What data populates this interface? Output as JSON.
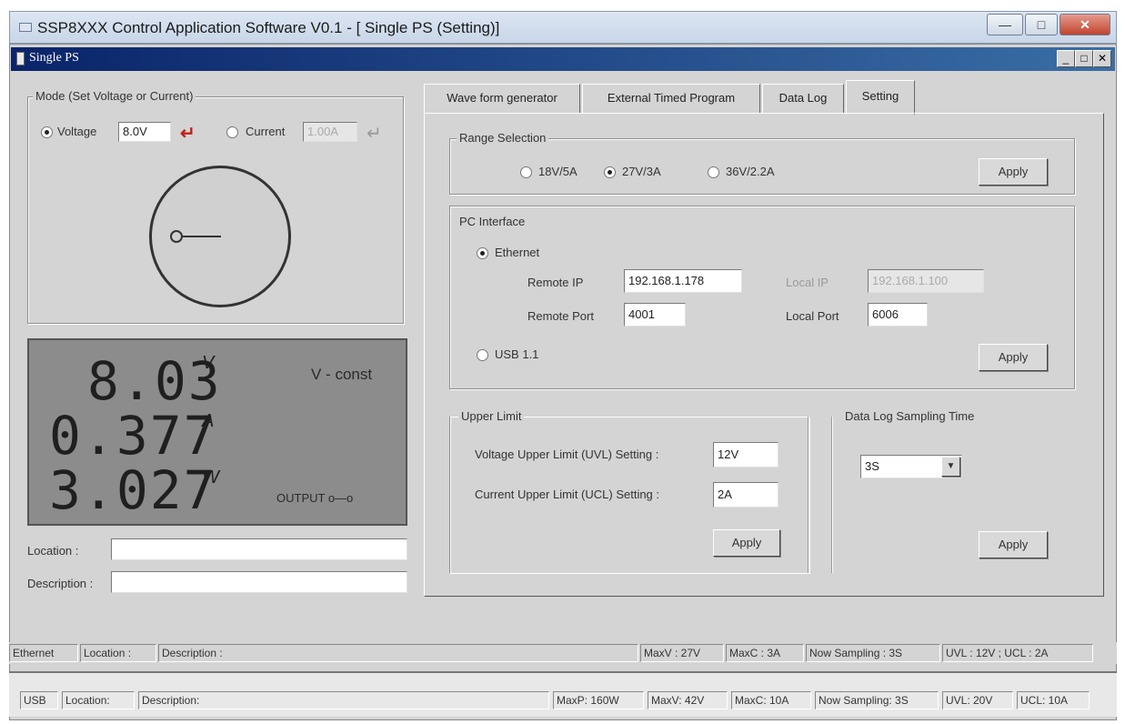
{
  "outer_window": {
    "title": "SSP8XXX Control Application Software V0.1 - [ Single PS (Setting)]"
  },
  "inner_window": {
    "title": "Single PS"
  },
  "mode": {
    "legend": "Mode (Set Voltage or Current)",
    "voltage_label": "Voltage",
    "voltage_value": "8.0V",
    "current_label": "Current",
    "current_value": "1.00A"
  },
  "display": {
    "voltage": "8.03",
    "voltage_unit": "V",
    "current": "0.377",
    "current_unit": "A",
    "power": "3.027",
    "power_unit": "W",
    "mode_text": "V - const",
    "output_text": "OUTPUT o—o"
  },
  "location_label": "Location :",
  "description_label": "Description :",
  "tabs": [
    "Wave form generator",
    "External Timed Program",
    "Data Log",
    "Setting"
  ],
  "range": {
    "legend": "Range Selection",
    "options": [
      "18V/5A",
      "27V/3A",
      "36V/2.2A"
    ],
    "apply": "Apply"
  },
  "pc_interface": {
    "legend": "PC Interface",
    "ethernet": "Ethernet",
    "remote_ip_label": "Remote IP",
    "remote_ip": "192.168.1.178",
    "local_ip_label": "Local IP",
    "local_ip": "192.168.1.100",
    "remote_port_label": "Remote Port",
    "remote_port": "4001",
    "local_port_label": "Local Port",
    "local_port": "6006",
    "usb": "USB 1.1",
    "apply": "Apply"
  },
  "upper_limit": {
    "legend": "Upper Limit",
    "uvl_label": "Voltage Upper Limit (UVL) Setting :",
    "uvl": "12V",
    "ucl_label": "Current Upper Limit (UCL) Setting :",
    "ucl": "2A",
    "apply": "Apply"
  },
  "datalog": {
    "legend": "Data Log Sampling Time",
    "value": "3S",
    "apply": "Apply"
  },
  "status1": [
    "Ethernet",
    "Location :",
    "Description :",
    "MaxV : 27V",
    "MaxC : 3A",
    "Now Sampling : 3S",
    "UVL : 12V ; UCL : 2A"
  ],
  "status2": [
    "USB",
    "Location:",
    "Description:",
    "MaxP: 160W",
    "MaxV: 42V",
    "MaxC: 10A",
    "Now Sampling: 3S",
    "UVL: 20V",
    "UCL: 10A"
  ]
}
